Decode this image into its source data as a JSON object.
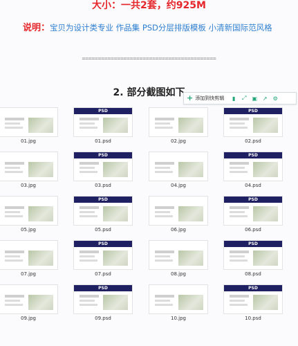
{
  "header": {
    "size_text": "大小：一共2套，约925M",
    "desc_label": "说明：",
    "desc_text": "宝贝为设计类专业 作品集 PSD分层排版模板 小清新国际范风格",
    "separator": "=========================================="
  },
  "section_title": "2. 部分截图如下",
  "toolbar": {
    "add_label": "添加到快剪辑",
    "icons": [
      "bookmark-icon",
      "expand-icon",
      "save-icon",
      "share-icon",
      "settings-icon"
    ]
  },
  "psd_badge": "PSD",
  "grid": {
    "rows": [
      [
        "01.jpg",
        "01.psd",
        "02.jpg",
        "02.psd"
      ],
      [
        "03.jpg",
        "03.psd",
        "04.jpg",
        "04.psd"
      ],
      [
        "05.jpg",
        "05.psd",
        "06.jpg",
        "06.psd"
      ],
      [
        "07.jpg",
        "07.psd",
        "08.jpg",
        "08.psd"
      ],
      [
        "09.jpg",
        "09.psd",
        "10.jpg",
        "10.psd"
      ]
    ]
  },
  "colors": {
    "red": "#e5262b",
    "blue": "#2e7fd0",
    "psd_bar": "#1e2061",
    "toolbar_green": "#1fa67a"
  }
}
